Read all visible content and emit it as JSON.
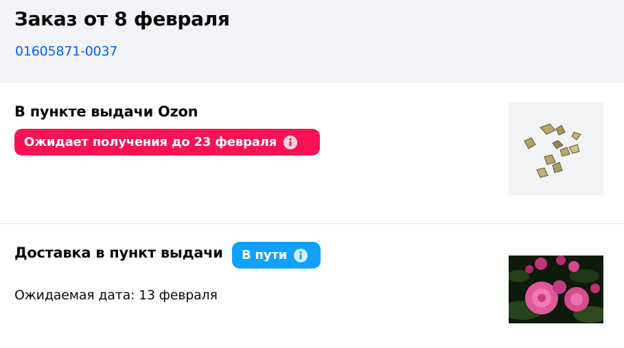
{
  "order": {
    "title": "Заказ от 8 февраля",
    "number": "01605871-0037"
  },
  "shipments": [
    {
      "title": "В пункте выдачи Ozon",
      "badge": "Ожидает получения до 23 февраля",
      "badge_color": "#f91155",
      "image_icon": "seeds-product-image"
    },
    {
      "title": "Доставка в пункт выдачи",
      "badge": "В пути",
      "badge_color": "#10a1ff",
      "expected_date": "Ожидаемая дата: 13 февраля",
      "image_icon": "roses-product-image"
    }
  ],
  "colors": {
    "link": "#005bff",
    "header_bg": "#f2f3f7"
  }
}
